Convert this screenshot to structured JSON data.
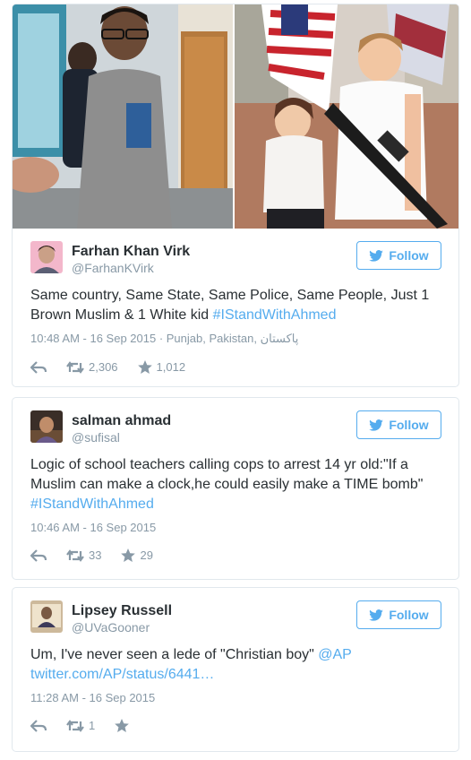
{
  "tweets": [
    {
      "name": "Farhan Khan Virk",
      "handle": "@FarhanKVirk",
      "follow_label": "Follow",
      "text_line1": "Same country, Same State, Same Police, Same People, Just 1",
      "text_line2_plain": "Brown Muslim & 1 White kid ",
      "text_line2_link": "#IStandWithAhmed",
      "meta": "10:48 AM - 16 Sep 2015 · Punjab, Pakistan, پاکستان",
      "retweets": "2,306",
      "favorites": "1,012"
    },
    {
      "name": "salman ahmad",
      "handle": "@sufisal",
      "follow_label": "Follow",
      "text_line1": "Logic of school teachers calling cops to arrest 14 yr old:\"If a",
      "text_line2_plain": "Muslim can make a clock,he could easily make a TIME bomb\"",
      "text_line3_link": "#IStandWithAhmed",
      "meta": "10:46 AM - 16 Sep 2015",
      "retweets": "33",
      "favorites": "29"
    },
    {
      "name": "Lipsey Russell",
      "handle": "@UVaGooner",
      "follow_label": "Follow",
      "text_line1_plain": "Um, I've never seen a lede of \"Christian boy\" ",
      "text_line1_link": "@AP",
      "text_line2_link": "twitter.com/AP/status/6441…",
      "meta": "11:28 AM - 16 Sep 2015",
      "retweets": "1",
      "favorites": ""
    }
  ],
  "colors": {
    "accent": "#55acee",
    "muted": "#8899a6",
    "text": "#292f33",
    "border": "#e1e8ed"
  },
  "icons": [
    "bird-icon",
    "reply-icon",
    "retweet-icon",
    "star-icon"
  ]
}
